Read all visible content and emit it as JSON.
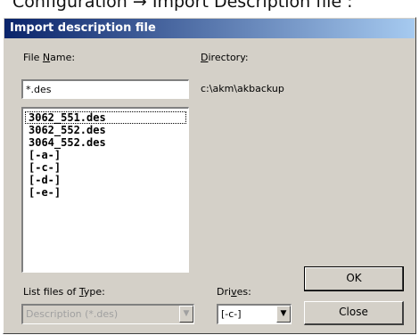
{
  "caption": "Configuration → Import Description file :",
  "dialog": {
    "title": "Import description file",
    "file_name_label_pre": "File ",
    "file_name_label_key": "N",
    "file_name_label_post": "ame:",
    "file_name_value": "*.des",
    "directory_label_key": "D",
    "directory_label_post": "irectory:",
    "directory_value": "c:\\akm\\akbackup",
    "files": [
      "3062_551.des",
      "3062_552.des",
      "3064_552.des",
      "[-a-]",
      "[-c-]",
      "[-d-]",
      "[-e-]"
    ],
    "file_type_label_pre": "List files of ",
    "file_type_label_key": "T",
    "file_type_label_post": "ype:",
    "file_type_value": "Description (*.des)",
    "drives_label_pre": "Dri",
    "drives_label_key": "v",
    "drives_label_post": "es:",
    "drives_value": "[-c-]",
    "ok_label": "OK",
    "close_label": "Close"
  }
}
